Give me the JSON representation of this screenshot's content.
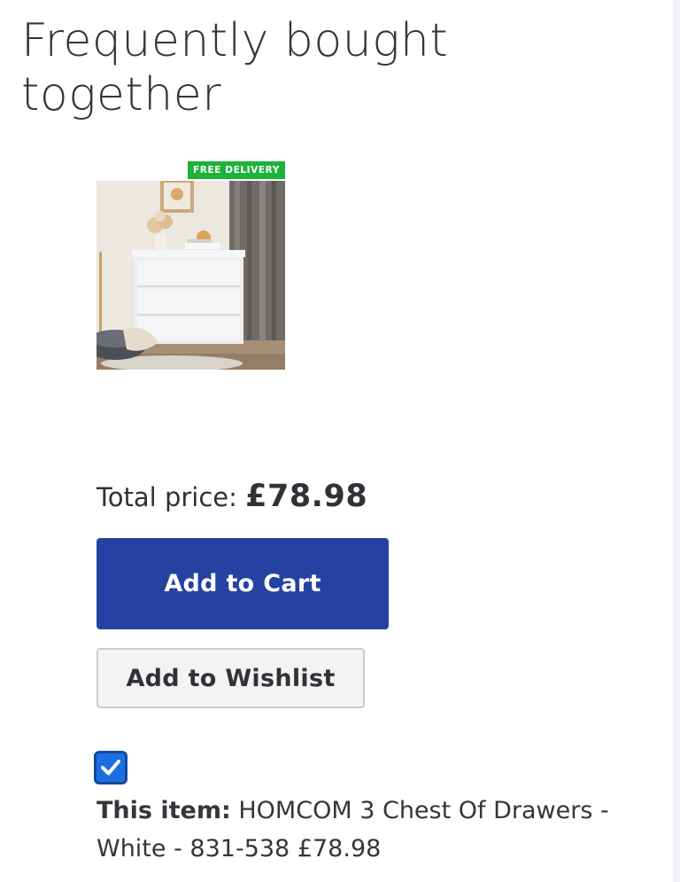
{
  "section": {
    "title": "Frequently bought together"
  },
  "product": {
    "badge": "FREE DELIVERY",
    "image_alt": "White three drawer chest in a living room"
  },
  "total": {
    "label": "Total price:",
    "price": "£78.98"
  },
  "buttons": {
    "add_to_cart": "Add to Cart",
    "add_to_wishlist": "Add to Wishlist"
  },
  "item": {
    "checked": true,
    "label": "This item:",
    "name": "HOMCOM 3 Chest Of Drawers - White - 831-538",
    "price": "£78.98"
  },
  "colors": {
    "accent_blue": "#2541a2",
    "badge_green": "#1bb33a",
    "checkbox_blue": "#1b6fe3"
  },
  "icons": {
    "checkbox": "check-icon"
  }
}
